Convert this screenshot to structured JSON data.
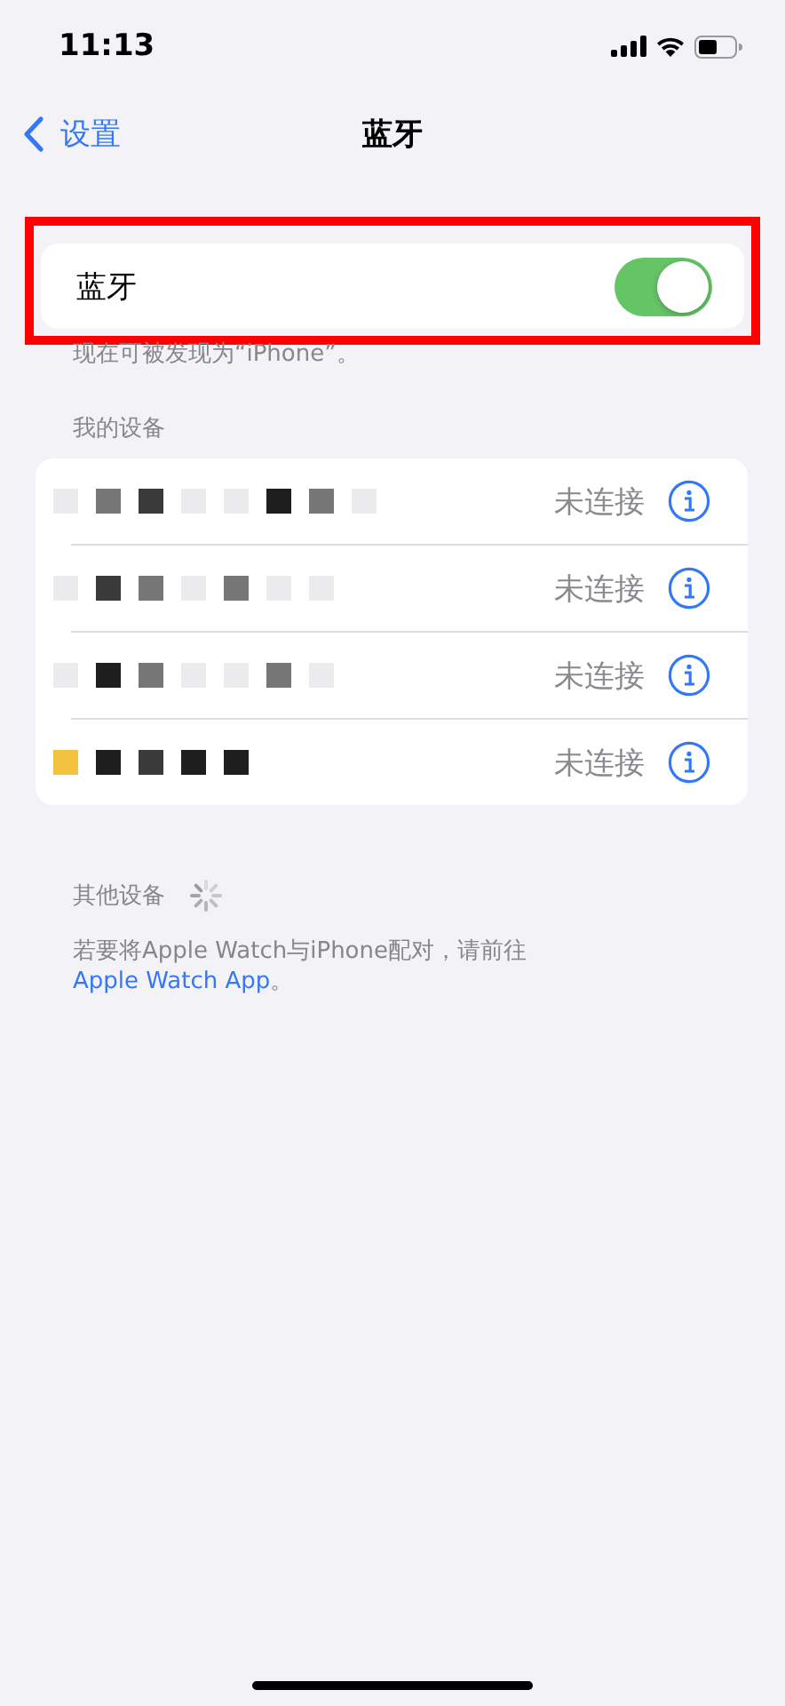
{
  "status_bar": {
    "time": "11:13"
  },
  "nav": {
    "back": "设置",
    "title": "蓝牙"
  },
  "bluetooth": {
    "label": "蓝牙",
    "on": true,
    "highlighted": true
  },
  "discoverable_note": "现在可被发现为“iPhone”。",
  "my_devices": {
    "header": "我的设备",
    "devices": [
      {
        "status": "未连接"
      },
      {
        "status": "未连接"
      },
      {
        "status": "未连接"
      },
      {
        "status": "未连接"
      }
    ]
  },
  "other_devices": {
    "header": "其他设备",
    "searching": true
  },
  "pairing_note": {
    "text": "若要将Apple Watch与iPhone配对，请前往",
    "link": "Apple Watch App",
    "end": "。"
  }
}
